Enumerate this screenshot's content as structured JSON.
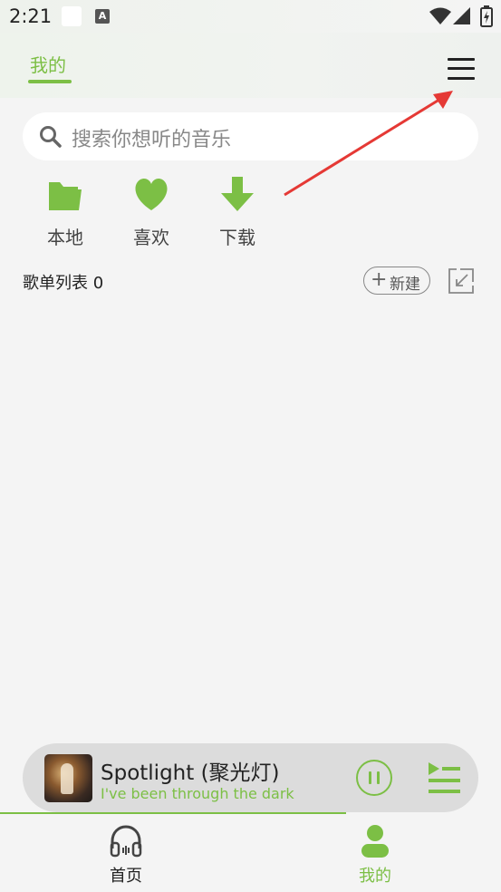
{
  "status_bar": {
    "time": "2:21",
    "icons": [
      "notification-square-icon",
      "a-badge-icon",
      "wifi-icon",
      "signal-icon",
      "battery-icon"
    ],
    "a_badge": "A"
  },
  "header": {
    "tab_label": "我的",
    "menu_icon": "hamburger-menu-icon"
  },
  "search": {
    "placeholder": "搜索你想听的音乐",
    "icon": "search-icon"
  },
  "quick_actions": [
    {
      "label": "本地",
      "icon": "folder-icon"
    },
    {
      "label": "喜欢",
      "icon": "heart-icon"
    },
    {
      "label": "下载",
      "icon": "download-arrow-icon"
    }
  ],
  "playlists": {
    "title": "歌单列表 0",
    "new_button_label": "新建",
    "new_button_icon": "plus-icon",
    "import_icon": "import-icon"
  },
  "player": {
    "title": "Spotlight (聚光灯)",
    "lyric": "I've been through the dark",
    "pause_icon": "pause-icon",
    "queue_icon": "playlist-queue-icon"
  },
  "bottom_nav": [
    {
      "label": "首页",
      "icon": "headphones-icon",
      "active": false
    },
    {
      "label": "我的",
      "icon": "user-icon",
      "active": true
    }
  ],
  "colors": {
    "accent": "#7cbf45",
    "annotation_arrow": "#e53935",
    "background": "#f4f4f4"
  }
}
